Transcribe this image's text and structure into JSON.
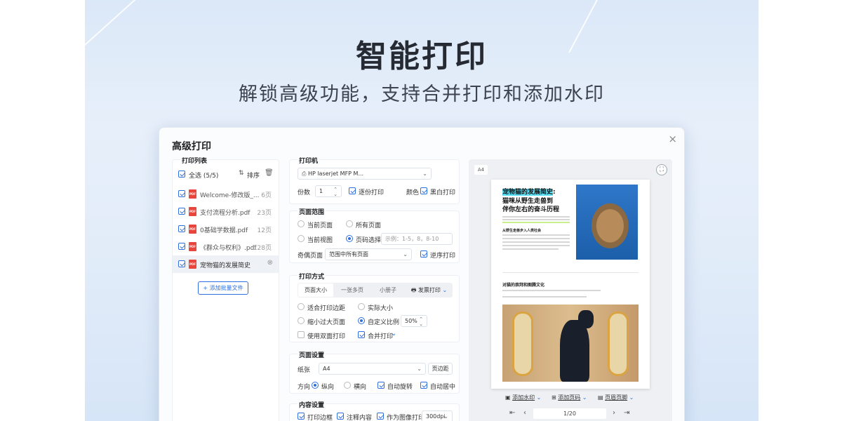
{
  "hero": {
    "title": "智能打印",
    "subtitle": "解锁高级功能，支持合并打印和添加水印"
  },
  "dialog": {
    "title": "高级打印",
    "close_icon": "×",
    "print_list": {
      "heading": "打印列表",
      "select_all": "全选 (5/5)",
      "sort_label": "排序",
      "files": [
        {
          "name": "Welcome-修改版_...",
          "pages": "6页"
        },
        {
          "name": "支付流程分析.pdf",
          "pages": "23页"
        },
        {
          "name": "0基础学数据.pdf",
          "pages": "12页"
        },
        {
          "name": "《群众与权利》.pdf",
          "pages": "128页"
        },
        {
          "name": "宠物猫的发展简史",
          "pages": ""
        }
      ],
      "add_button": "添加批量文件"
    },
    "printer": {
      "heading": "打印机",
      "device": "HP laserjet MFP M...",
      "copies_label": "份数",
      "copies_value": "1",
      "collate_label": "逐份打印",
      "color_label": "颜色",
      "bw_label": "黑白打印"
    },
    "page_range": {
      "heading": "页面范围",
      "current_page": "当前页面",
      "all_pages": "所有页面",
      "current_view": "当前视图",
      "page_select": "页码选择",
      "page_placeholder": "示例：1-5，8，8-10",
      "odd_even_label": "奇偶页面",
      "odd_even_value": "范围中所有页面",
      "reverse_label": "逆序打印"
    },
    "print_mode": {
      "heading": "打印方式",
      "tabs": [
        "页面大小",
        "一张多页",
        "小册子",
        "发票打印"
      ],
      "fit_margin": "适合打印边距",
      "actual_size": "实际大小",
      "shrink_large": "缩小过大页面",
      "custom_scale": "自定义比例",
      "scale_value": "50%",
      "duplex": "使用双面打印",
      "merge": "合并打印"
    },
    "page_setup": {
      "heading": "页面设置",
      "paper_label": "纸张",
      "paper_value": "A4",
      "margin_button": "页边距",
      "orientation_label": "方向",
      "portrait": "纵向",
      "landscape": "横向",
      "auto_rotate": "自动旋转",
      "auto_center": "自动居中"
    },
    "content_setup": {
      "heading": "内容设置",
      "border": "打印边框",
      "annotations": "注释内容",
      "as_image": "作为图像打印",
      "dpi": "300dpi"
    },
    "preview": {
      "paper_badge": "A4",
      "doc_title_highlight": "宠物猫的发展简史",
      "doc_title_rest": ":",
      "doc_subtitle_1": "猫咪从野生走兽到",
      "doc_subtitle_2": "伴你左右的奋斗历程",
      "doc_section_1": "从野生走兽步入人类社会",
      "doc_section_2": "对猫的崇拜和图腾文化",
      "add_watermark": "添加水印",
      "add_page_number": "添加页码",
      "header_footer": "页眉页脚",
      "page_indicator": "1/20"
    }
  },
  "colors": {
    "accent": "#2f6fe0",
    "pdf_red": "#e8453c",
    "highlight": "#5ce0f5"
  }
}
